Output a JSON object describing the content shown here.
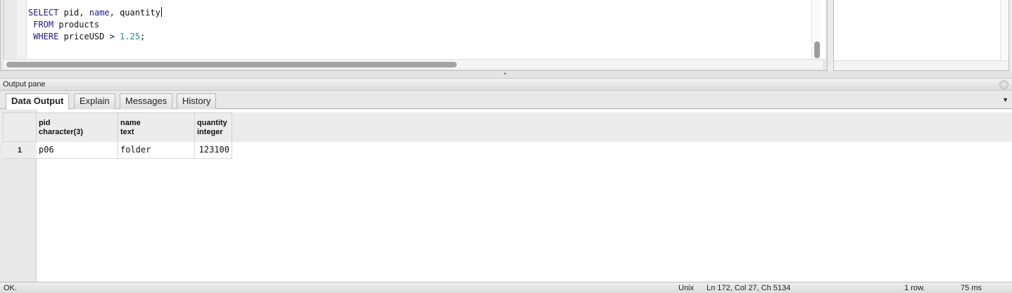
{
  "editor": {
    "lines": [
      [
        {
          "t": "SELECT",
          "c": "kw"
        },
        {
          "t": " pid, ",
          "c": ""
        },
        {
          "t": "name",
          "c": "kw"
        },
        {
          "t": ", quantity",
          "c": ""
        }
      ],
      [
        {
          "t": " FROM",
          "c": "kw"
        },
        {
          "t": " products",
          "c": ""
        }
      ],
      [
        {
          "t": " WHERE",
          "c": "kw"
        },
        {
          "t": " priceUSD > ",
          "c": ""
        },
        {
          "t": "1.25",
          "c": "num"
        },
        {
          "t": ";",
          "c": ""
        }
      ]
    ]
  },
  "output_pane": {
    "title": "Output pane",
    "close_icon": "close-icon",
    "tabs": [
      "Data Output",
      "Explain",
      "Messages",
      "History"
    ],
    "active_tab": "Data Output"
  },
  "grid": {
    "columns": [
      {
        "name": "pid",
        "type": "character(3)"
      },
      {
        "name": "name",
        "type": "text"
      },
      {
        "name": "quantity",
        "type": "integer"
      }
    ],
    "rows": [
      {
        "num": "1",
        "cells": [
          "p06",
          "folder",
          "123100"
        ]
      }
    ]
  },
  "status": {
    "message": "OK.",
    "line_endings": "Unix",
    "position": "Ln 172, Col 27, Ch 5134",
    "row_count": "1 row.",
    "duration": "75 ms"
  },
  "colors": {
    "keyword": "#1a1a8c",
    "number": "#1f8a8a"
  }
}
